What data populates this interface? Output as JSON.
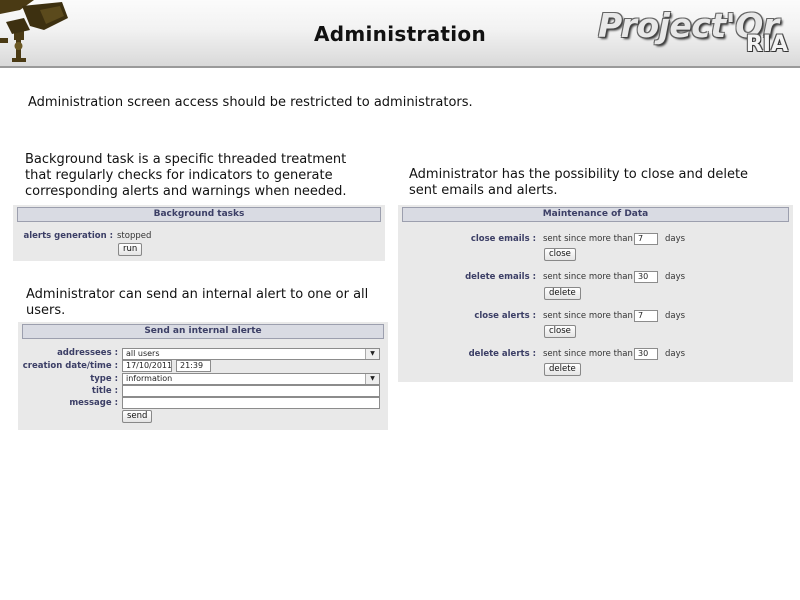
{
  "header": {
    "title": "Administration",
    "brand": "Project'Or",
    "brand_suffix": "RIA"
  },
  "notes": {
    "restrict": "Administration screen access should be restricted to administrators.",
    "background": "Background task is a specific threaded treatment that regularly checks for indicators to generate corresponding alerts and warnings when needed.",
    "alert": "Administrator can send an internal alert to one or all users.",
    "maintenance": "Administrator has the possibility to close and delete sent emails and alerts."
  },
  "background_tasks": {
    "title": "Background tasks",
    "alerts_label": "alerts generation :",
    "alerts_status": "stopped",
    "run_label": "run"
  },
  "send_alert": {
    "title": "Send an internal alerte",
    "addressees_label": "addressees :",
    "addressees_value": "all users",
    "date_label": "creation date/time :",
    "date_value": "17/10/2011",
    "time_value": "21:39",
    "type_label": "type :",
    "type_value": "information",
    "title_label": "title :",
    "title_value": "",
    "message_label": "message :",
    "message_value": "",
    "send_label": "send"
  },
  "maintenance": {
    "title": "Maintenance of Data",
    "sent_text": "sent since more than",
    "days_text": "days",
    "rows": [
      {
        "label": "close emails :",
        "value": "7",
        "button": "close"
      },
      {
        "label": "delete emails :",
        "value": "30",
        "button": "delete"
      },
      {
        "label": "close alerts :",
        "value": "7",
        "button": "close"
      },
      {
        "label": "delete alerts :",
        "value": "30",
        "button": "delete"
      }
    ]
  },
  "colors": {
    "panel_bg": "#e9e9e9",
    "panel_header_bg": "#d9dbe3",
    "label_color": "#3c3f66"
  }
}
